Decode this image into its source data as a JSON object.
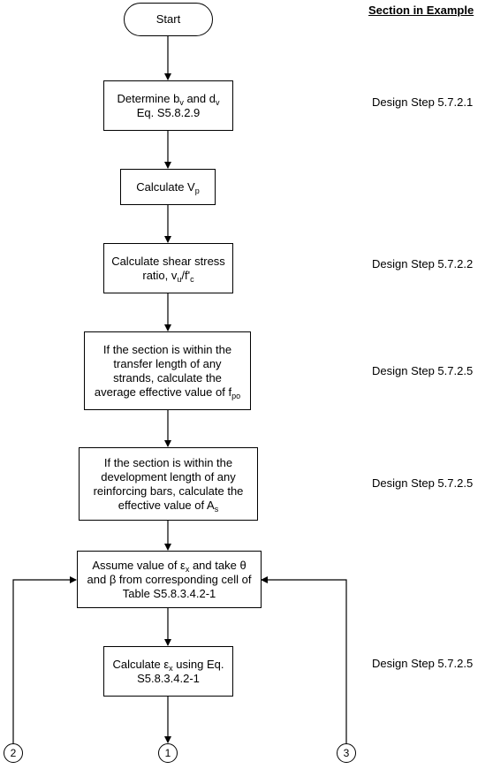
{
  "header": {
    "section_column_title": "Section in Example"
  },
  "flowchart": {
    "start": {
      "label": "Start"
    },
    "steps": [
      {
        "id": "determine-bv-dv",
        "line1_pre": "Determine b",
        "line1_sub1": "v",
        "line1_mid": " and d",
        "line1_sub2": "v",
        "line2": "Eq. S5.8.2.9",
        "reference": "Design Step 5.7.2.1"
      },
      {
        "id": "calculate-vp",
        "text_pre": "Calculate V",
        "text_sub": "p",
        "reference": ""
      },
      {
        "id": "shear-stress-ratio",
        "line1": "Calculate shear stress",
        "line2_pre": "ratio, v",
        "line2_sub1": "u",
        "line2_mid": "/f'",
        "line2_sub2": "c",
        "reference": "Design Step 5.7.2.2"
      },
      {
        "id": "transfer-length",
        "line1": "If the section is within the",
        "line2": "transfer length of any",
        "line3": "strands, calculate the",
        "line4_pre": "average effective value of f",
        "line4_sub": "po",
        "reference": "Design Step 5.7.2.5"
      },
      {
        "id": "development-length",
        "line1": "If the section is within the",
        "line2": "development length of any",
        "line3": "reinforcing bars, calculate the",
        "line4_pre": "effective value of A",
        "line4_sub": "s",
        "reference": "Design Step 5.7.2.5"
      },
      {
        "id": "assume-ex",
        "line1_pre": "Assume value of ε",
        "line1_sub": "x",
        "line1_post": " and take θ",
        "line2": "and β from corresponding cell of",
        "line3": "Table S5.8.3.4.2-1",
        "reference": ""
      },
      {
        "id": "calculate-ex",
        "line1_pre": "Calculate ε",
        "line1_sub": "x",
        "line1_post": " using Eq.",
        "line2": "S5.8.3.4.2-1",
        "reference": "Design Step 5.7.2.5"
      }
    ],
    "connectors": [
      {
        "label": "2",
        "position": "bottom-left",
        "role": "loop-back-input"
      },
      {
        "label": "1",
        "position": "bottom-center",
        "role": "continue-output"
      },
      {
        "label": "3",
        "position": "bottom-right",
        "role": "loop-back-input"
      }
    ]
  }
}
